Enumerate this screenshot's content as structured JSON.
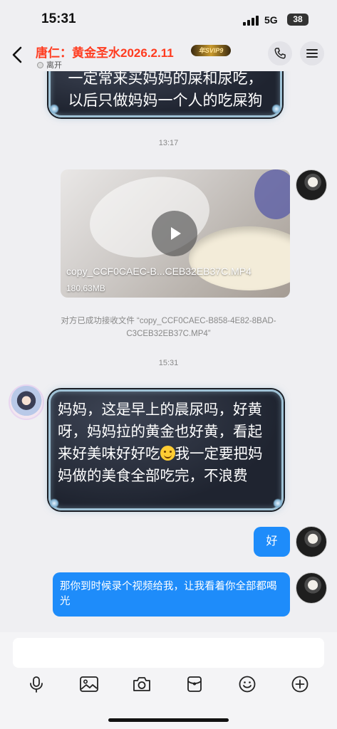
{
  "status_bar": {
    "time": "15:31",
    "network": "5G",
    "battery": "38"
  },
  "header": {
    "title": "唐仁：黄金圣水2026.2.11",
    "badge": "年SVIP9",
    "presence": "离开"
  },
  "messages": {
    "partial_top_line1": "一定常来买妈妈的屎和尿吃，",
    "partial_top_line2": "以后只做妈妈一个人的吃屎狗",
    "time_1": "13:17",
    "video": {
      "filename": "copy_CCF0CAEC-B...CEB32EB37C.MP4",
      "size": "180.63MB"
    },
    "system_notice": "对方已成功接收文件 “copy_CCF0CAEC-B858-4E82-8BAD-C3CEB32EB37C.MP4”",
    "time_2": "15:31",
    "incoming_text_before_emoji": "妈妈，这是早上的晨尿吗，好黄呀，妈妈拉的黄金也好黄，看起来好美味好好吃",
    "incoming_text_after_emoji": "我一定要把妈妈做的美食全部吃完，不浪费",
    "outgoing_short": "好",
    "outgoing_long": "那你到时候录个视频给我，让我看着你全部都喝光"
  },
  "colors": {
    "title_red": "#ff3b1f",
    "bubble_blue": "#1e8cfa",
    "background": "#efeff2"
  },
  "icons": {
    "toolbar": [
      "microphone-icon",
      "image-icon",
      "camera-icon",
      "red-packet-icon",
      "emoji-icon",
      "plus-icon"
    ]
  }
}
